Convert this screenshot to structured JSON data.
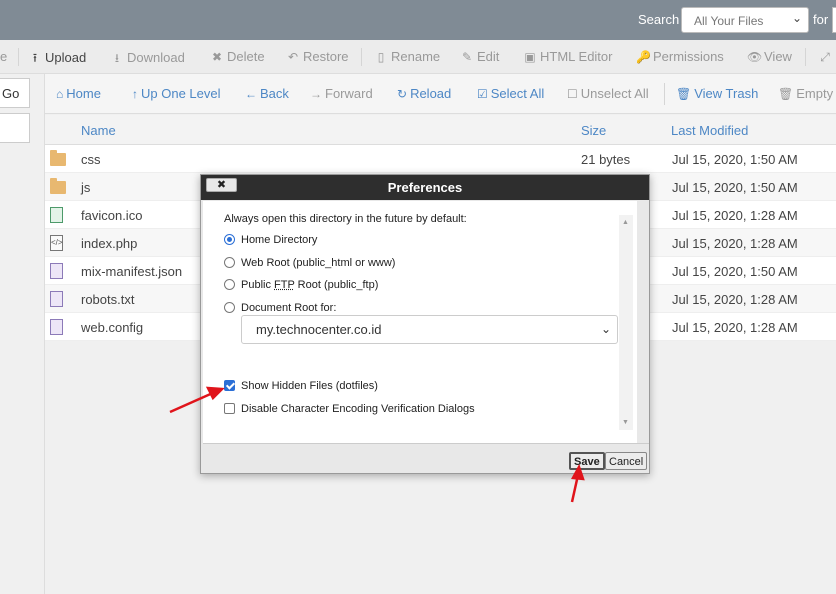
{
  "topbar": {
    "search_label": "Search",
    "search_scope": "All Your Files",
    "for_label": "for"
  },
  "toolbar": {
    "items": [
      {
        "label": "e",
        "icon": "partial-icon"
      },
      {
        "label": "Upload",
        "icon": "upload-icon"
      },
      {
        "label": "Download",
        "icon": "download-icon"
      },
      {
        "label": "Delete",
        "icon": "delete-icon"
      },
      {
        "label": "Restore",
        "icon": "restore-icon"
      },
      {
        "label": "Rename",
        "icon": "rename-icon"
      },
      {
        "label": "Edit",
        "icon": "edit-icon"
      },
      {
        "label": "HTML Editor",
        "icon": "html-editor-icon"
      },
      {
        "label": "Permissions",
        "icon": "permissions-icon"
      },
      {
        "label": "View",
        "icon": "view-icon"
      }
    ]
  },
  "left": {
    "go_label": "Go"
  },
  "nav": {
    "items": [
      {
        "label": "Home",
        "icon": "home-icon"
      },
      {
        "label": "Up One Level",
        "icon": "up-level-icon"
      },
      {
        "label": "Back",
        "icon": "back-arrow-icon"
      },
      {
        "label": "Forward",
        "icon": "forward-arrow-icon"
      },
      {
        "label": "Reload",
        "icon": "reload-icon"
      },
      {
        "label": "Select All",
        "icon": "select-all-icon"
      },
      {
        "label": "Unselect All",
        "icon": "unselect-all-icon"
      },
      {
        "label": "View Trash",
        "icon": "trash-icon"
      },
      {
        "label": "Empty T",
        "icon": "empty-trash-icon"
      }
    ]
  },
  "files": {
    "headers": {
      "name": "Name",
      "size": "Size",
      "modified": "Last Modified"
    },
    "rows": [
      {
        "name": "css",
        "size": "21 bytes",
        "modified": "Jul 15, 2020, 1:50 AM",
        "icon": "folder-icon"
      },
      {
        "name": "js",
        "size": "",
        "modified": "Jul 15, 2020, 1:50 AM",
        "icon": "folder-icon"
      },
      {
        "name": "favicon.ico",
        "size": "",
        "modified": "Jul 15, 2020, 1:28 AM",
        "icon": "image-file-icon"
      },
      {
        "name": "index.php",
        "size": "",
        "modified": "Jul 15, 2020, 1:28 AM",
        "icon": "code-file-icon"
      },
      {
        "name": "mix-manifest.json",
        "size": "",
        "modified": "Jul 15, 2020, 1:50 AM",
        "icon": "document-icon"
      },
      {
        "name": "robots.txt",
        "size": "",
        "modified": "Jul 15, 2020, 1:28 AM",
        "icon": "document-icon"
      },
      {
        "name": "web.config",
        "size": "",
        "modified": "Jul 15, 2020, 1:28 AM",
        "icon": "document-icon"
      }
    ]
  },
  "dialog": {
    "title": "Preferences",
    "close_label": "✖",
    "default_dir_label": "Always open this directory in the future by default:",
    "options": {
      "home": "Home Directory",
      "webroot": "Web Root (public_html or www)",
      "ftp_prefix": "Public ",
      "ftp_abbr": "FTP",
      "ftp_suffix": " Root (public_ftp)",
      "docroot": "Document Root for:"
    },
    "docroot_value": "my.technocenter.co.id",
    "show_hidden": "Show Hidden Files (dotfiles)",
    "disable_encoding": "Disable Character Encoding Verification Dialogs",
    "save_label": "Save",
    "cancel_label": "Cancel",
    "selected_option": "home",
    "show_hidden_checked": true,
    "disable_encoding_checked": false
  },
  "annotation_color": "#e0141b"
}
